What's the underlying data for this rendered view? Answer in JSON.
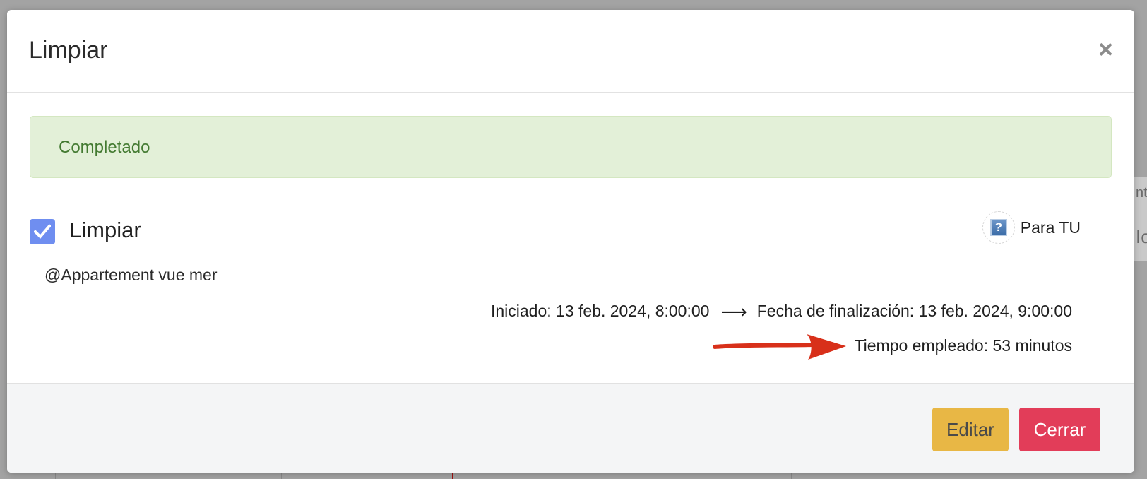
{
  "modal": {
    "title": "Limpiar",
    "close_symbol": "×"
  },
  "status_alert": {
    "text": "Completado",
    "color": "#437a31",
    "background": "#e3f0d8"
  },
  "task": {
    "checked": true,
    "name": "Limpiar",
    "location": "@Appartement vue mer",
    "check_color": "#6f8ef0"
  },
  "assignee": {
    "icon": "question-mark-icon",
    "avatar_symbol": "?",
    "name": "Para TU"
  },
  "timing": {
    "started": "Iniciado: 13 feb. 2024, 8:00:00",
    "arrow_symbol": "⟶",
    "finished": "Fecha de finalización: 13 feb. 2024, 9:00:00",
    "elapsed": "Tiempo empleado: 53 minutos"
  },
  "annotation": {
    "icon": "red-arrow-annotation",
    "color": "#d8301a"
  },
  "footer": {
    "edit_label": "Editar",
    "close_label": "Cerrar",
    "edit_color": "#e8b745",
    "close_color": "#e23d59"
  },
  "background": {
    "peek_text_1": "nto",
    "peek_text_2": "Io"
  }
}
